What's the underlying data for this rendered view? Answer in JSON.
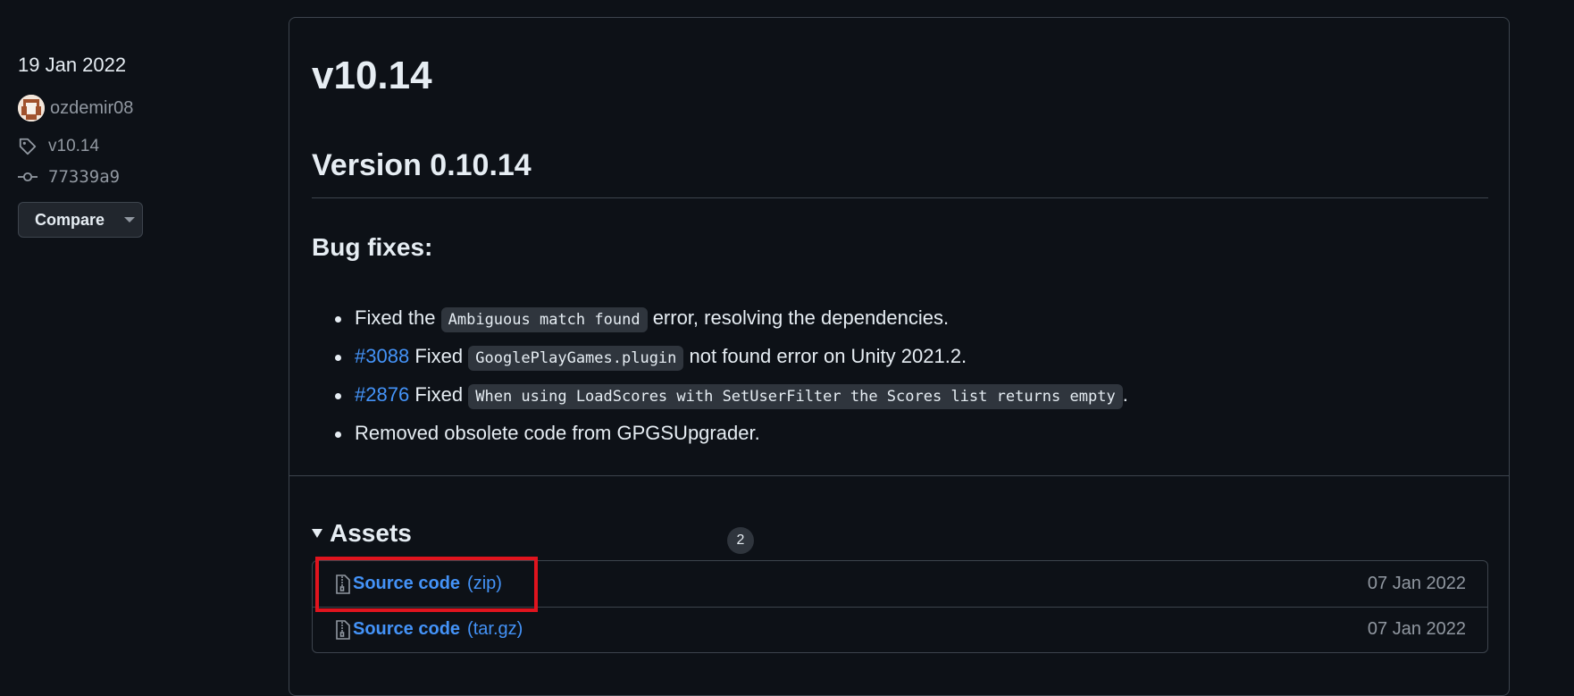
{
  "sidebar": {
    "date": "19 Jan 2022",
    "author": "ozdemir08",
    "tag": "v10.14",
    "commit": "77339a9",
    "compare_label": "Compare"
  },
  "release": {
    "title": "v10.14",
    "version_heading": "Version 0.10.14",
    "bug_fixes_heading": "Bug fixes:",
    "bullets": [
      {
        "text_before": "Fixed the",
        "code": "Ambiguous match found",
        "text_after": "error, resolving the dependencies."
      },
      {
        "issue": "#3088",
        "text_before": "Fixed",
        "code": "GooglePlayGames.plugin",
        "text_after": "not found error on Unity 2021.2."
      },
      {
        "issue": "#2876",
        "text_before": "Fixed",
        "code": "When using LoadScores with SetUserFilter the Scores list returns empty",
        "text_after": "."
      },
      {
        "text": "Removed obsolete code from GPGSUpgrader."
      }
    ]
  },
  "assets": {
    "label": "Assets",
    "count": "2",
    "items": [
      {
        "name": "Source code",
        "ext": "(zip)",
        "date": "07 Jan 2022"
      },
      {
        "name": "Source code",
        "ext": "(tar.gz)",
        "date": "07 Jan 2022"
      }
    ]
  },
  "colors": {
    "background": "#0d1117",
    "link": "#4493f8",
    "highlight": "#e0141e"
  },
  "icons": [
    "avatar",
    "tag-icon",
    "git-commit-icon",
    "caret-down-icon",
    "triangle-down-icon",
    "file-zip-icon"
  ]
}
